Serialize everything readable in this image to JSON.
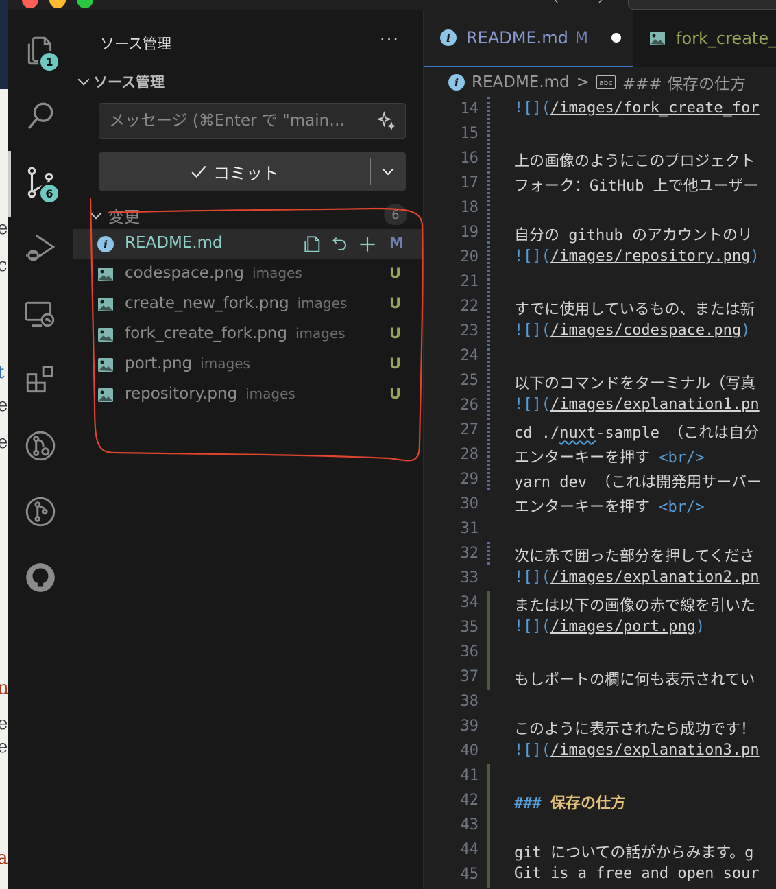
{
  "sidebar": {
    "title": "ソース管理",
    "more": "···",
    "section_title": "ソース管理",
    "message_placeholder": "メッセージ (⌘Enter で \"main…",
    "commit_label": "コミット",
    "changes_label": "変更",
    "changes_count": "6",
    "files": [
      {
        "name": "README.md",
        "dir": "",
        "status": "M"
      },
      {
        "name": "codespace.png",
        "dir": "images",
        "status": "U"
      },
      {
        "name": "create_new_fork.png",
        "dir": "images",
        "status": "U"
      },
      {
        "name": "fork_create_fork.png",
        "dir": "images",
        "status": "U"
      },
      {
        "name": "port.png",
        "dir": "images",
        "status": "U"
      },
      {
        "name": "repository.png",
        "dir": "images",
        "status": "U"
      }
    ]
  },
  "activity": {
    "explorer_badge": "1",
    "scm_badge": "6"
  },
  "editor": {
    "tabs": [
      {
        "label": "README.md",
        "mod": "M"
      },
      {
        "label": "fork_create_"
      }
    ],
    "breadcrumb": {
      "file": "README.md",
      "sep": ">",
      "symbol_icon": "abc",
      "symbol": "### 保存の仕方"
    },
    "lines": [
      {
        "n": "14",
        "p": [
          "![](",
          "/images/fork_create_for"
        ]
      },
      {
        "n": "15",
        "t": ""
      },
      {
        "n": "16",
        "t": "上の画像のようにこのプロジェクト"
      },
      {
        "n": "17",
        "t": "フォーク：GitHub 上で他ユーザー"
      },
      {
        "n": "18",
        "t": ""
      },
      {
        "n": "19",
        "t": "自分の github のアカウントのリ"
      },
      {
        "n": "20",
        "p": [
          "![](",
          "/images/repository.png",
          ")"
        ]
      },
      {
        "n": "21",
        "t": ""
      },
      {
        "n": "22",
        "t": "すでに使用しているもの、または新"
      },
      {
        "n": "23",
        "p": [
          "![](",
          "/images/codespace.png",
          ")"
        ]
      },
      {
        "n": "24",
        "t": ""
      },
      {
        "n": "25",
        "t": "以下のコマンドをターミナル（写真"
      },
      {
        "n": "26",
        "p": [
          "![](",
          "/images/explanation1.pn"
        ]
      },
      {
        "n": "27",
        "s": [
          "cd ./",
          "nuxt",
          "-sample （これは自分"
        ]
      },
      {
        "n": "28",
        "b": [
          "エンターキーを押す ",
          "<br/>"
        ]
      },
      {
        "n": "29",
        "t": "yarn dev （これは開発用サーバー"
      },
      {
        "n": "30",
        "b": [
          "エンターキーを押す ",
          "<br/>"
        ]
      },
      {
        "n": "31",
        "t": ""
      },
      {
        "n": "32",
        "t": "次に赤で囲った部分を押してくださ"
      },
      {
        "n": "33",
        "p": [
          "![](",
          "/images/explanation2.pn"
        ]
      },
      {
        "n": "34",
        "t": "または以下の画像の赤で線を引いた"
      },
      {
        "n": "35",
        "p": [
          "![](",
          "/images/port.png",
          ")"
        ]
      },
      {
        "n": "36",
        "t": ""
      },
      {
        "n": "37",
        "t": "もしポートの欄に何も表示されてい"
      },
      {
        "n": "38",
        "t": ""
      },
      {
        "n": "39",
        "t": "このように表示されたら成功です！"
      },
      {
        "n": "40",
        "p": [
          "![](",
          "/images/explanation3.pn"
        ]
      },
      {
        "n": "41",
        "t": ""
      },
      {
        "n": "42",
        "h": [
          "###",
          "保存の仕方"
        ]
      },
      {
        "n": "43",
        "t": ""
      },
      {
        "n": "44",
        "t": "git についての話がからみます。g"
      },
      {
        "n": "45",
        "t": "Git is a free and open sour"
      }
    ]
  },
  "colors": {
    "accent": "#3a79c9",
    "badge": "#6ec9c0",
    "modified": "#6f7fb2",
    "untracked": "#9aa35a",
    "annotation": "#e0442c"
  }
}
